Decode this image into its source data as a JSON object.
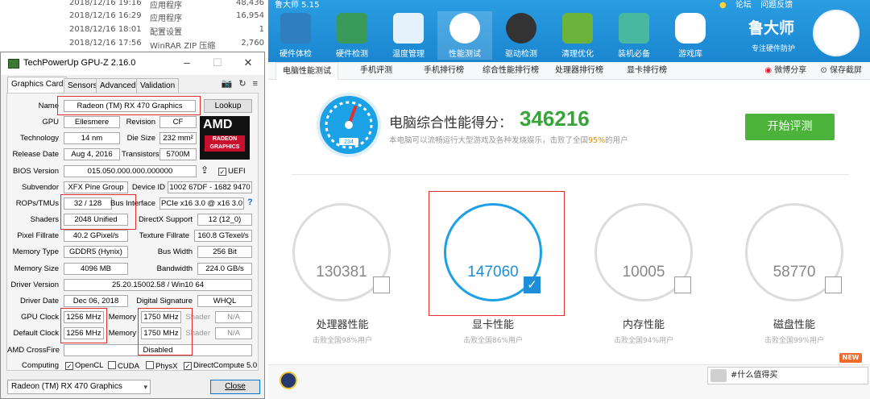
{
  "explorer": {
    "rows": [
      {
        "date": "2018/12/16 19:16",
        "type": "应用程序",
        "size": "48,436"
      },
      {
        "date": "2018/12/16 16:29",
        "type": "应用程序",
        "size": "16,954"
      },
      {
        "date": "2018/12/16 18:01",
        "type": "配置设置",
        "size": "1"
      },
      {
        "date": "2018/12/16 17:56",
        "type": "WinRAR ZIP 压缩",
        "size": "2,760"
      }
    ]
  },
  "gpuz": {
    "title": "TechPowerUp GPU-Z 2.16.0",
    "tabs": [
      "Graphics Card",
      "Sensors",
      "Advanced",
      "Validation"
    ],
    "name_label": "Name",
    "name": "Radeon (TM) RX 470 Graphics",
    "lookup": "Lookup",
    "gpu_label": "GPU",
    "gpu": "Ellesmere",
    "revision_label": "Revision",
    "revision": "CF",
    "tech_label": "Technology",
    "tech": "14 nm",
    "die_label": "Die Size",
    "die": "232 mm²",
    "release_label": "Release Date",
    "release": "Aug 4, 2016",
    "trans_label": "Transistors",
    "trans": "5700M",
    "bios_label": "BIOS Version",
    "bios": "015.050.000.000.000000",
    "uefi": "UEFI",
    "subvendor_label": "Subvendor",
    "subvendor": "XFX Pine Group",
    "devid_label": "Device ID",
    "devid": "1002 67DF - 1682 9470",
    "rops_label": "ROPs/TMUs",
    "rops": "32 / 128",
    "bus_label": "Bus Interface",
    "bus": "PCIe x16 3.0 @ x16 3.0",
    "bus_help": "?",
    "shaders_label": "Shaders",
    "shaders": "2048 Unified",
    "dx_label": "DirectX Support",
    "dx": "12 (12_0)",
    "pixel_label": "Pixel Fillrate",
    "pixel": "40.2 GPixel/s",
    "texture_label": "Texture Fillrate",
    "texture": "160.8 GTexel/s",
    "memtype_label": "Memory Type",
    "memtype": "GDDR5 (Hynix)",
    "buswidth_label": "Bus Width",
    "buswidth": "256 Bit",
    "memsize_label": "Memory Size",
    "memsize": "4096 MB",
    "bandwidth_label": "Bandwidth",
    "bandwidth": "224.0 GB/s",
    "driver_label": "Driver Version",
    "driver": "25.20.15002.58 / Win10 64",
    "driverdate_label": "Driver Date",
    "driverdate": "Dec 06, 2018",
    "digsig_label": "Digital Signature",
    "digsig": "WHQL",
    "gpuclock_label": "GPU Clock",
    "gpuclock": "1256 MHz",
    "mem_label": "Memory",
    "mem": "1750 MHz",
    "shader_label": "Shader",
    "shader": "N/A",
    "defclock_label": "Default Clock",
    "defclock": "1256 MHz",
    "defmem": "1750 MHz",
    "defshader": "N/A",
    "crossfire_label": "AMD CrossFire",
    "crossfire": "Disabled",
    "computing_label": "Computing",
    "computing": [
      "OpenCL",
      "CUDA",
      "PhysX",
      "DirectCompute 5.0"
    ],
    "card_select": "Radeon (TM) RX 470 Graphics",
    "close": "Close",
    "amd_logo": "AMD",
    "radeon_logo": "RADEON GRAPHICS"
  },
  "lds": {
    "title": "鲁大师 5.15",
    "toplinks": [
      "论坛",
      "问题反馈"
    ],
    "nav": [
      "硬件体检",
      "硬件检测",
      "温度管理",
      "性能测试",
      "驱动检测",
      "清理优化",
      "装机必备",
      "游戏库"
    ],
    "brand": "鲁大师",
    "brand_sub": "专注硬件防护",
    "subtabs": [
      "电脑性能测试",
      "手机评测",
      "手机排行榜",
      "综合性能排行榜",
      "处理器排行榜",
      "显卡排行榜"
    ],
    "share": [
      "微博分享",
      "保存截屏"
    ],
    "score_label": "电脑综合性能得分：",
    "score": "346216",
    "score_sub_pre": "本电脑可以流畅运行大型游戏及各种发烧娱乐，击败了全国",
    "score_sub_pct": "95%",
    "score_sub_post": "的用户",
    "gauge_num": "234",
    "start_btn": "开始评测",
    "cards": [
      {
        "value": "130381",
        "label": "处理器性能",
        "sub": "击败全国98%用户",
        "checked": false
      },
      {
        "value": "147060",
        "label": "显卡性能",
        "sub": "击败全国86%用户",
        "checked": true
      },
      {
        "value": "10005",
        "label": "内存性能",
        "sub": "击败全国94%用户",
        "checked": false
      },
      {
        "value": "58770",
        "label": "磁盘性能",
        "sub": "击败全国99%用户",
        "checked": false
      }
    ],
    "new_badge": "NEW",
    "promo": "#什么值得买"
  },
  "colors": {
    "accent": "#1a86d0",
    "score_green": "#36a436",
    "button_green": "#4cb33a",
    "highlight_red": "#e03030"
  }
}
